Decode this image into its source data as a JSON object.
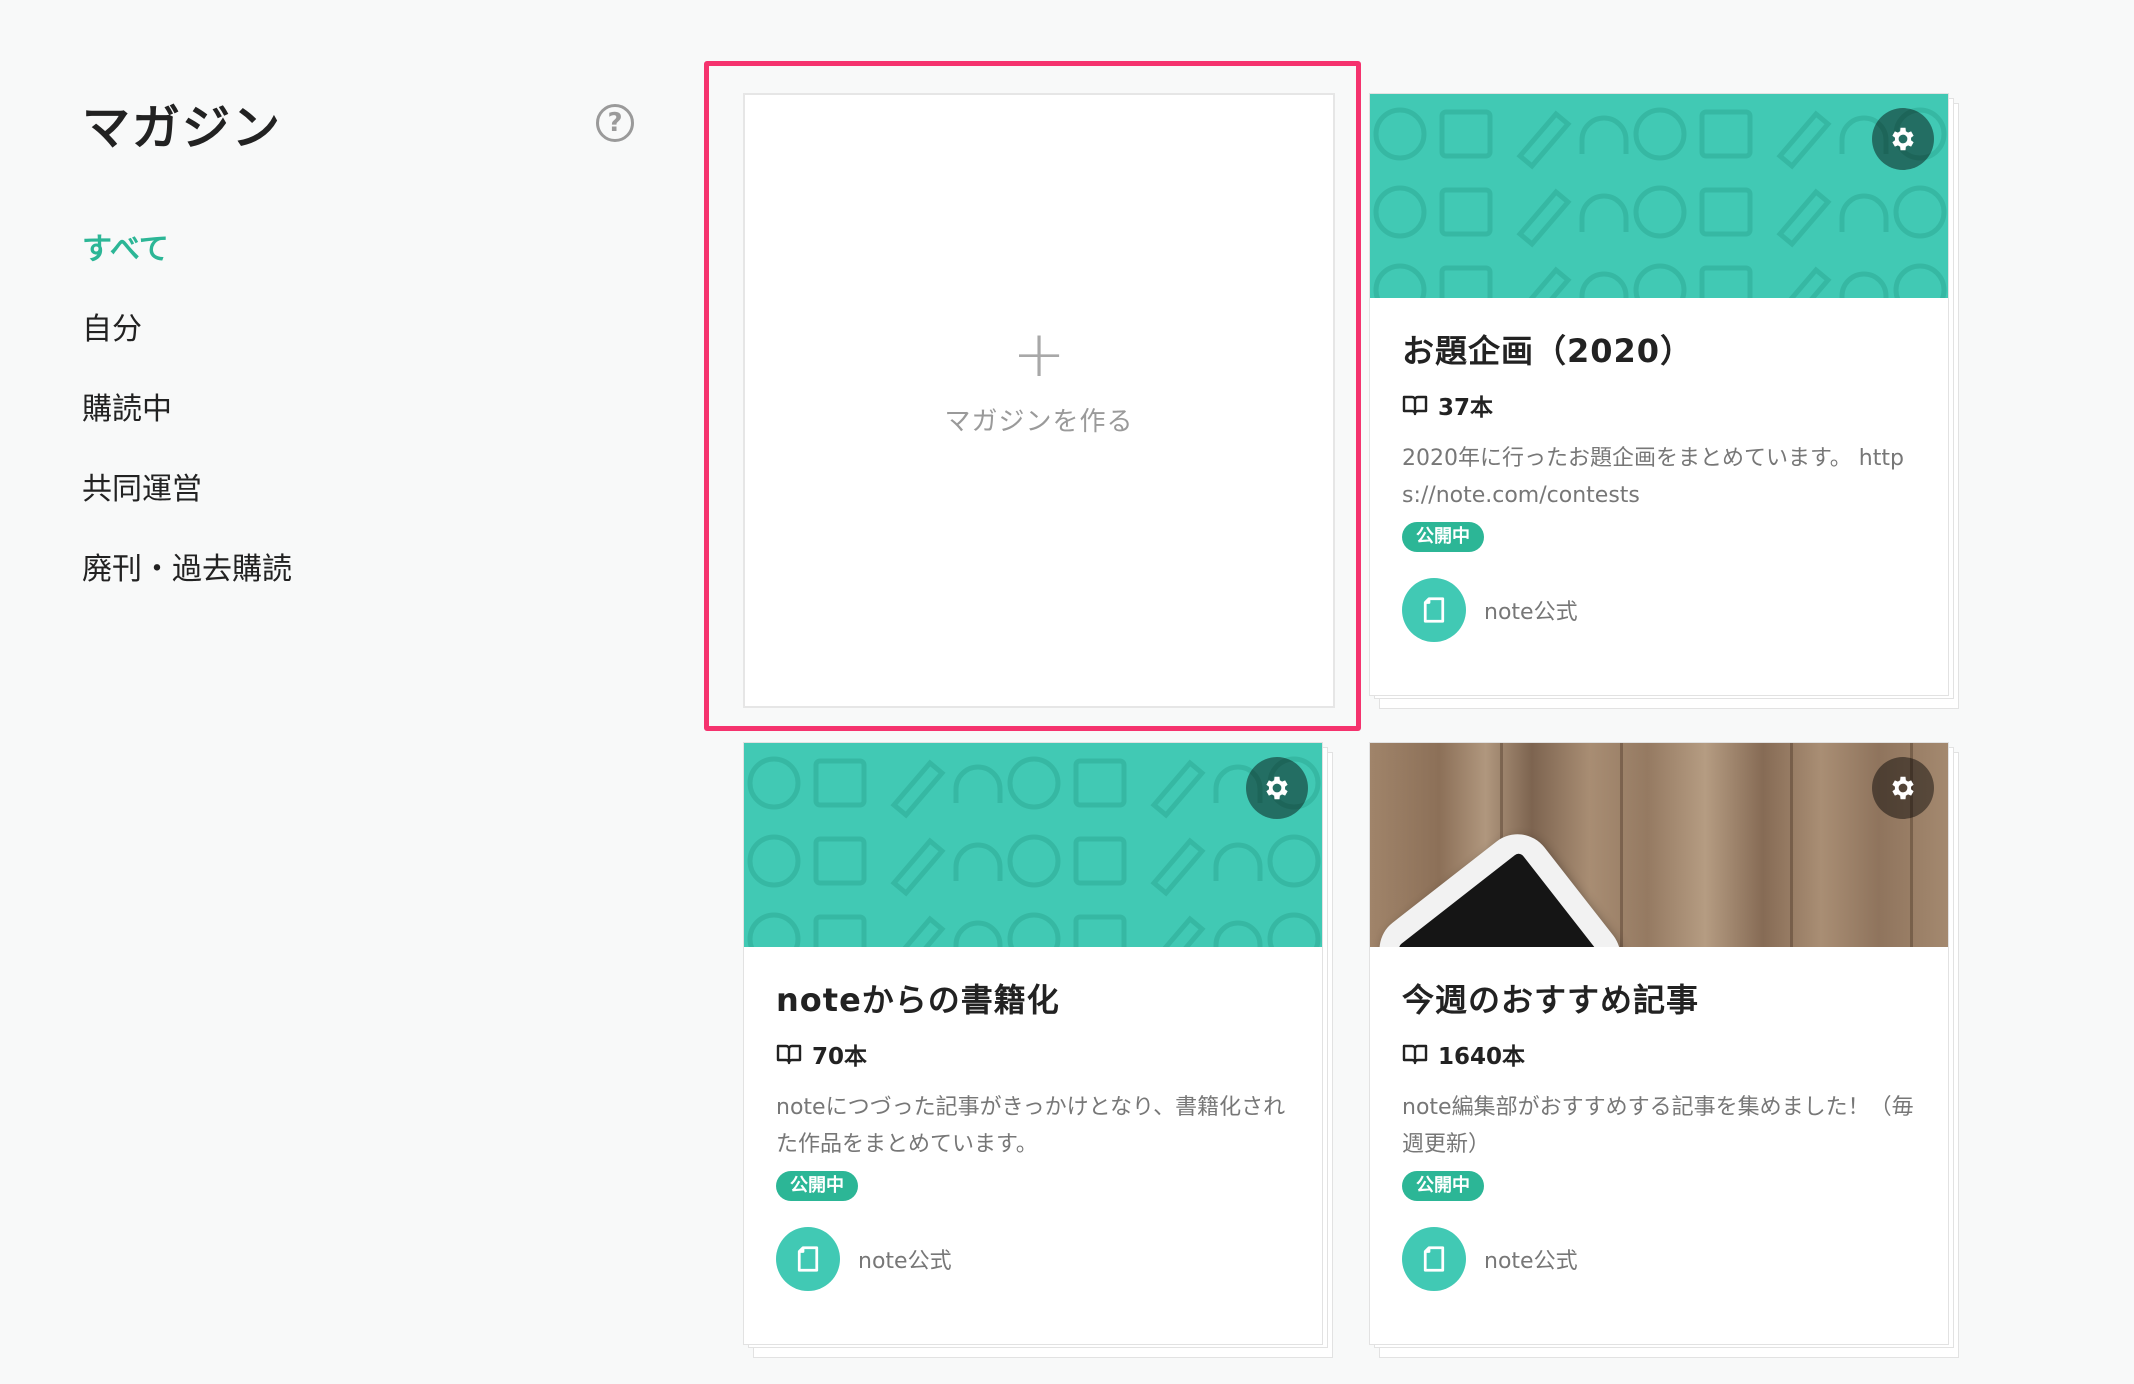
{
  "sidebar": {
    "title": "マガジン",
    "help_icon": "?",
    "items": [
      {
        "label": "すべて",
        "active": true
      },
      {
        "label": "自分",
        "active": false
      },
      {
        "label": "購読中",
        "active": false
      },
      {
        "label": "共同運営",
        "active": false
      },
      {
        "label": "廃刊・過去購読",
        "active": false
      }
    ]
  },
  "create_card": {
    "plus": "+",
    "label": "マガジンを作る"
  },
  "magazines": [
    {
      "title": "お題企画（2020）",
      "count": "37本",
      "description": "2020年に行ったお題企画をまとめています。 https://note.com/contests",
      "badge": "公開中",
      "author": "note公式",
      "cover": "green-pattern"
    },
    {
      "title": "noteからの書籍化",
      "count": "70本",
      "description": "noteにつづった記事がきっかけとなり、書籍化された作品をまとめています。",
      "badge": "公開中",
      "author": "note公式",
      "cover": "green-pattern"
    },
    {
      "title": "今週のおすすめ記事",
      "count": "1640本",
      "description": "note編集部がおすすめする記事を集めました！（毎週更新）",
      "badge": "公開中",
      "author": "note公式",
      "cover": "wood-photo"
    }
  ],
  "colors": {
    "accent": "#2cb696",
    "cover_green": "#41c9b4",
    "highlight": "#f5336e"
  },
  "icons": {
    "help": "question-circle-icon",
    "plus": "plus-icon",
    "gear": "gear-icon",
    "book": "book-icon",
    "avatar": "note-logo-icon"
  }
}
